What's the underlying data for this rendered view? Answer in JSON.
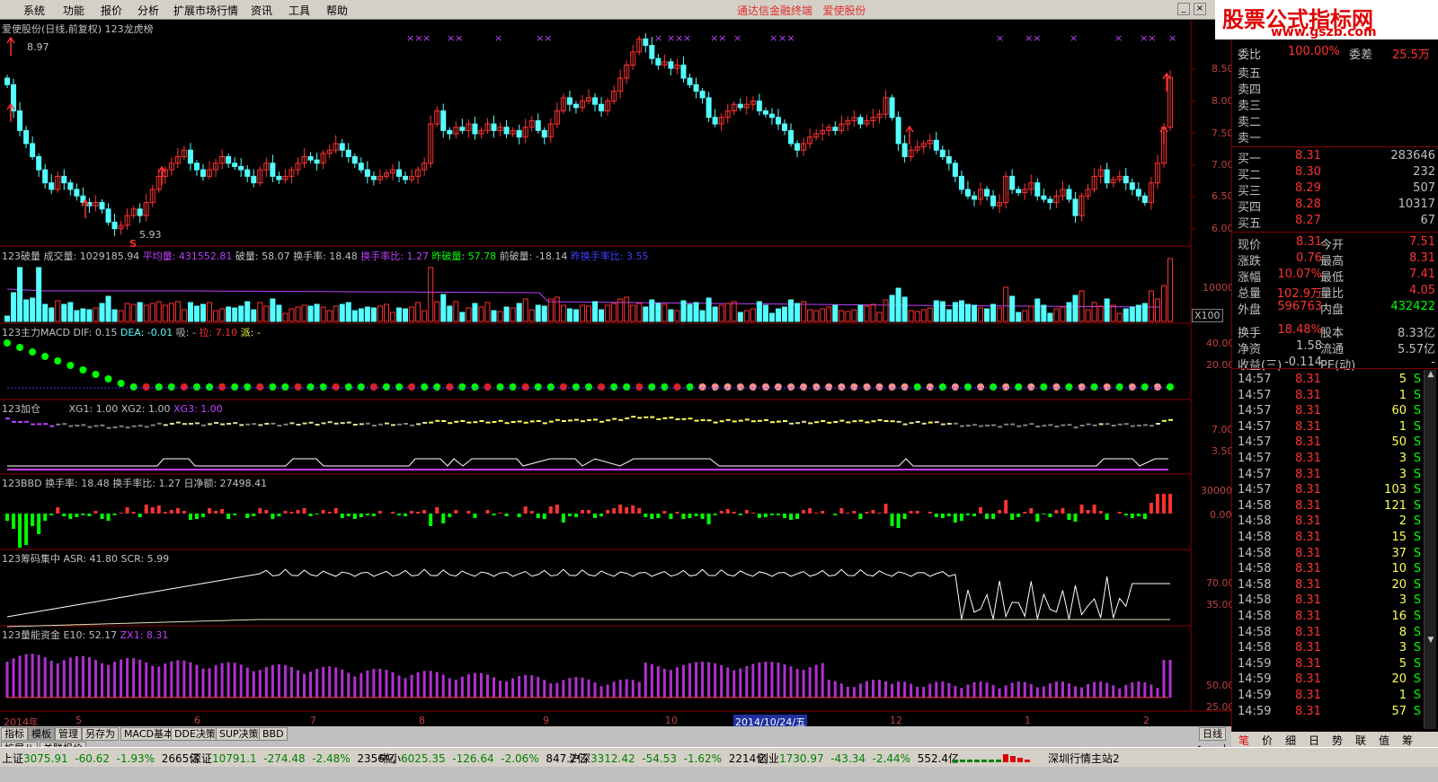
{
  "menu": [
    "系统",
    "功能",
    "报价",
    "分析",
    "扩展市场行情",
    "资讯",
    "工具",
    "帮助"
  ],
  "window_title": {
    "app": "通达信金融终端",
    "stock": "爱使股份"
  },
  "logo": {
    "line1": "股票公式指标网",
    "line2": "www.gszb.com"
  },
  "colors": {
    "up": "#ff3232",
    "down": "#54ffff",
    "panel_border": "#8b0000",
    "purple": "#c040ff",
    "yellow": "#ffff54",
    "green": "#00ff00",
    "white": "#ffffff",
    "bg": "#000000"
  },
  "main_chart": {
    "title": "爱使股份(日线,前复权) 123龙虎榜",
    "high_label": "8.97",
    "low_label": "5.93",
    "marker_s": "S",
    "x_marks": [
      "××",
      "×",
      "××",
      "×",
      "××",
      "×",
      "××",
      "×",
      "××",
      "×",
      "×",
      "××",
      "×",
      "××",
      "×",
      "×",
      "××",
      "×"
    ],
    "y_ticks": [
      "8.50",
      "8.00",
      "7.50",
      "7.00",
      "6.50",
      "6.00"
    ]
  },
  "chart_data": [
    {
      "type": "candlestick",
      "name": "price",
      "y_range": [
        5.9,
        9.0
      ],
      "close": [
        8.2,
        7.8,
        7.5,
        7.3,
        7.1,
        6.9,
        6.7,
        6.6,
        6.8,
        6.7,
        6.6,
        6.5,
        6.4,
        6.35,
        6.4,
        6.3,
        6.1,
        6.0,
        6.05,
        6.2,
        6.3,
        6.2,
        6.4,
        6.6,
        6.8,
        6.9,
        7.0,
        7.1,
        7.2,
        7.0,
        6.9,
        6.8,
        6.9,
        7.0,
        7.1,
        7.0,
        6.95,
        6.9,
        6.8,
        6.7,
        6.9,
        7.0,
        6.8,
        6.75,
        6.8,
        6.9,
        7.0,
        7.1,
        7.05,
        7.0,
        7.15,
        7.2,
        7.3,
        7.2,
        7.1,
        7.0,
        6.9,
        6.8,
        6.75,
        6.8,
        6.85,
        6.9,
        6.8,
        6.75,
        6.8,
        6.9,
        7.0,
        7.6,
        7.8,
        7.5,
        7.45,
        7.55,
        7.5,
        7.6,
        7.45,
        7.5,
        7.6,
        7.5,
        7.55,
        7.45,
        7.5,
        7.4,
        7.55,
        7.65,
        7.5,
        7.4,
        7.6,
        7.8,
        8.0,
        7.9,
        7.85,
        7.95,
        8.0,
        7.9,
        7.8,
        7.95,
        8.1,
        8.3,
        8.5,
        8.7,
        8.9,
        8.8,
        8.6,
        8.5,
        8.55,
        8.45,
        8.5,
        8.3,
        8.2,
        8.1,
        8.0,
        7.7,
        7.6,
        7.7,
        7.8,
        7.9,
        7.85,
        7.9,
        7.95,
        7.8,
        7.75,
        7.7,
        7.6,
        7.5,
        7.3,
        7.2,
        7.3,
        7.4,
        7.45,
        7.5,
        7.55,
        7.5,
        7.6,
        7.65,
        7.7,
        7.6,
        7.65,
        7.7,
        7.75,
        8.0,
        7.7,
        7.3,
        7.1,
        7.2,
        7.25,
        7.3,
        7.35,
        7.2,
        7.1,
        7.0,
        6.8,
        6.6,
        6.5,
        6.45,
        6.6,
        6.5,
        6.35,
        6.4,
        6.8,
        6.6,
        6.55,
        6.6,
        6.7,
        6.5,
        6.45,
        6.4,
        6.5,
        6.6,
        6.45,
        6.2,
        6.5,
        6.6,
        6.8,
        6.9,
        6.7,
        6.75,
        6.8,
        6.7,
        6.6,
        6.5,
        6.4,
        6.7,
        7.0,
        7.55,
        8.31
      ]
    },
    {
      "type": "bar",
      "name": "volume",
      "title": "123破量",
      "y_tick": "10000",
      "unit": "X100",
      "labels": {
        "vol": "成交量: 1029185.94",
        "avg": "平均量: 431552.81",
        "breaks": "破量: 58.07",
        "turnover": "换手率: 18.48",
        "turnover_ratio": "换手率比: 1.27",
        "prev_break": "昨破量: 57.78",
        "prev_break2": "前破量: -18.14",
        "prev_turnover_ratio": "昨换手率比: 3.55"
      }
    },
    {
      "type": "scatter",
      "name": "macd",
      "title": "123主力MACD",
      "labels": {
        "dif": "DIF: 0.15",
        "dea": "DEA: -0.01",
        "absorb": "吸: -",
        "pull": "拉: 7.10",
        "dispatch": "派: -"
      },
      "y_ticks": [
        "40.00",
        "20.00"
      ]
    },
    {
      "type": "line",
      "name": "add",
      "title": "123加仓",
      "labels": {
        "xg1": "XG1: 1.00",
        "xg2": "XG2: 1.00",
        "xg3": "XG3: 1.00"
      },
      "y_ticks": [
        "7.00",
        "3.50"
      ]
    },
    {
      "type": "bar",
      "name": "bbd",
      "title": "123BBD",
      "labels": {
        "turnover": "换手率: 18.48",
        "ratio": "换手率比: 1.27",
        "net": "日净额: 27498.41"
      },
      "y_ticks": [
        "30000",
        "0.00"
      ]
    },
    {
      "type": "line",
      "name": "chip",
      "title": "123筹码集中",
      "labels": {
        "asr": "ASR: 41.80",
        "scr": "SCR: 5.99"
      },
      "y_ticks": [
        "70.00",
        "35.00"
      ]
    },
    {
      "type": "bar",
      "name": "energy",
      "title": "123量能资金",
      "labels": {
        "e10": "E10: 52.17",
        "zx1": "ZX1: 8.31"
      },
      "y_ticks": [
        "50.00",
        "25.00"
      ]
    }
  ],
  "x_axis": {
    "labels": [
      "2014年",
      "5",
      "6",
      "7",
      "8",
      "9",
      "10",
      "2014/10/24/五",
      "12",
      "1",
      "2"
    ],
    "period": "日线"
  },
  "quote": {
    "top": {
      "label": "委比",
      "value": "100.00%",
      "label2": "委差",
      "value2": "25.5万"
    },
    "sell": [
      {
        "l": "卖五"
      },
      {
        "l": "卖四"
      },
      {
        "l": "卖三"
      },
      {
        "l": "卖二"
      },
      {
        "l": "卖一"
      }
    ],
    "buy": [
      {
        "l": "买一",
        "p": "8.31",
        "v": "283646"
      },
      {
        "l": "买二",
        "p": "8.30",
        "v": "232"
      },
      {
        "l": "买三",
        "p": "8.29",
        "v": "507"
      },
      {
        "l": "买四",
        "p": "8.28",
        "v": "10317"
      },
      {
        "l": "买五",
        "p": "8.27",
        "v": "67"
      }
    ],
    "stats": [
      {
        "l1": "现价",
        "v1": "8.31",
        "l2": "今开",
        "v2": "7.51"
      },
      {
        "l1": "涨跌",
        "v1": "0.76",
        "l2": "最高",
        "v2": "8.31"
      },
      {
        "l1": "涨幅",
        "v1": "10.07%",
        "l2": "最低",
        "v2": "7.41"
      },
      {
        "l1": "总量",
        "v1": "102.9万",
        "l2": "量比",
        "v2": "4.05"
      },
      {
        "l1": "外盘",
        "v1": "596763",
        "l2": "内盘",
        "v2": "432422"
      },
      {
        "l1": "换手",
        "v1": "18.48%",
        "l2": "股本",
        "v2": "8.33亿"
      },
      {
        "l1": "净资",
        "v1": "1.58",
        "l2": "流通",
        "v2": "5.57亿"
      },
      {
        "l1": "收益(三)",
        "v1": "-0.114",
        "l2": "PE(动)",
        "v2": "-"
      }
    ],
    "ticks": [
      {
        "t": "14:57",
        "p": "8.31",
        "v": "5",
        "s": "S"
      },
      {
        "t": "14:57",
        "p": "8.31",
        "v": "1",
        "s": "S"
      },
      {
        "t": "14:57",
        "p": "8.31",
        "v": "60",
        "s": "S"
      },
      {
        "t": "14:57",
        "p": "8.31",
        "v": "1",
        "s": "S"
      },
      {
        "t": "14:57",
        "p": "8.31",
        "v": "50",
        "s": "S"
      },
      {
        "t": "14:57",
        "p": "8.31",
        "v": "3",
        "s": "S"
      },
      {
        "t": "14:57",
        "p": "8.31",
        "v": "3",
        "s": "S"
      },
      {
        "t": "14:57",
        "p": "8.31",
        "v": "103",
        "s": "S"
      },
      {
        "t": "14:58",
        "p": "8.31",
        "v": "121",
        "s": "S"
      },
      {
        "t": "14:58",
        "p": "8.31",
        "v": "2",
        "s": "S"
      },
      {
        "t": "14:58",
        "p": "8.31",
        "v": "15",
        "s": "S"
      },
      {
        "t": "14:58",
        "p": "8.31",
        "v": "37",
        "s": "S"
      },
      {
        "t": "14:58",
        "p": "8.31",
        "v": "10",
        "s": "S"
      },
      {
        "t": "14:58",
        "p": "8.31",
        "v": "20",
        "s": "S"
      },
      {
        "t": "14:58",
        "p": "8.31",
        "v": "3",
        "s": "S"
      },
      {
        "t": "14:58",
        "p": "8.31",
        "v": "16",
        "s": "S"
      },
      {
        "t": "14:58",
        "p": "8.31",
        "v": "8",
        "s": "S"
      },
      {
        "t": "14:58",
        "p": "8.31",
        "v": "3",
        "s": "S"
      },
      {
        "t": "14:59",
        "p": "8.31",
        "v": "5",
        "s": "S"
      },
      {
        "t": "14:59",
        "p": "8.31",
        "v": "20",
        "s": "S"
      },
      {
        "t": "14:59",
        "p": "8.31",
        "v": "1",
        "s": "S"
      },
      {
        "t": "14:59",
        "p": "8.31",
        "v": "57",
        "s": "S"
      }
    ]
  },
  "bottom_tabs": [
    "指标",
    "模板",
    "管理",
    "另存为",
    "MACD基本",
    "DDE决策",
    "SUP决策",
    "BBD"
  ],
  "bottom_tabs2": [
    "扩展八",
    "关联报价"
  ],
  "rp_tabs": [
    "笔",
    "价",
    "细",
    "日",
    "势",
    "联",
    "值",
    "筹"
  ],
  "status": {
    "sh": {
      "name": "上证",
      "idx": "3075.91",
      "chg": "-60.62",
      "pct": "-1.93%",
      "amt": "2665亿"
    },
    "sz": {
      "name": "深证",
      "idx": "10791.1",
      "chg": "-274.48",
      "pct": "-2.48%",
      "amt": "2356亿"
    },
    "zx": {
      "name": "中小",
      "idx": "6025.35",
      "chg": "-126.64",
      "pct": "-2.06%",
      "amt": "847.2亿"
    },
    "hs": {
      "name": "沪深",
      "idx": "3312.42",
      "chg": "-54.53",
      "pct": "-1.62%",
      "amt": "2214亿"
    },
    "cy": {
      "name": "创业",
      "idx": "1730.97",
      "chg": "-43.34",
      "pct": "-2.44%",
      "amt": "552.4亿"
    },
    "server": "深圳行情主站2"
  }
}
